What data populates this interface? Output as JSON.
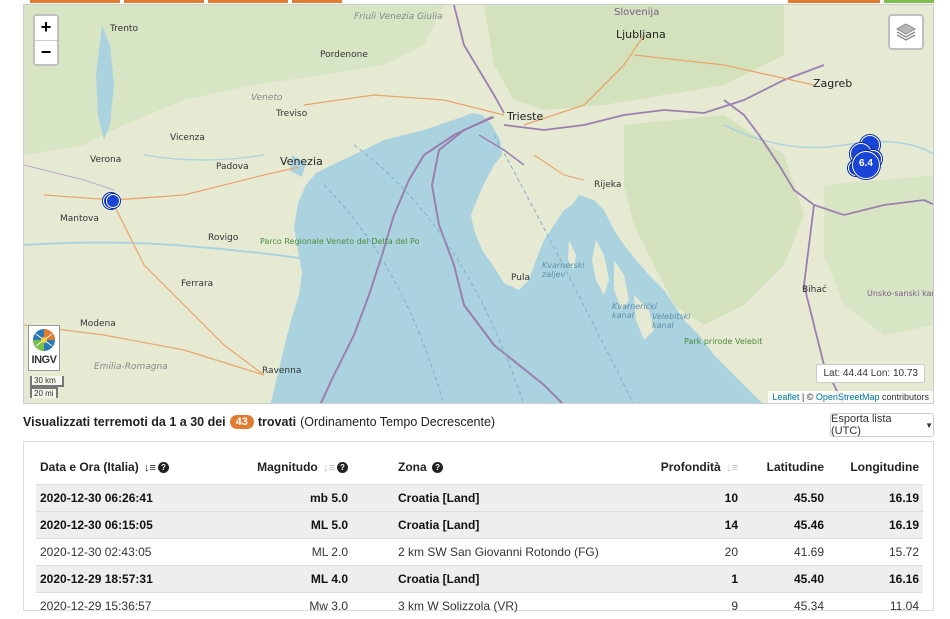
{
  "map": {
    "labels": {
      "trento": "Trento",
      "friuli": "Friuli Venezia Giulia",
      "slovenija": "Slovenija",
      "ljubljana": "Ljubljana",
      "pordenone": "Pordenone",
      "veneto": "Veneto",
      "treviso": "Treviso",
      "zagreb": "Zagreb",
      "trieste": "Trieste",
      "vicenza": "Vicenza",
      "venezia": "Venezia",
      "verona": "Verona",
      "padova": "Padova",
      "rijeka": "Rijeka",
      "mantova": "Mantova",
      "rovigo": "Rovigo",
      "park_po": "Parco Regionale Veneto del Delta del Po",
      "ferrara": "Ferrara",
      "pula": "Pula",
      "kvarnerski_zaljev": "Kvarnerski zaljev",
      "kvarnericki_kanal": "Kvarnerićki kanal",
      "velebitski_kanal": "Velebitski kanal",
      "park_velebit": "Park prirode Velebit",
      "bihac": "Bihać",
      "unsko": "Unsko-sanski kanton",
      "modena": "Modena",
      "emilia": "Emilia-Romagna",
      "ravenna": "Ravenna"
    },
    "zoom_in": "+",
    "zoom_out": "−",
    "logo_text": "INGV",
    "scale_km": "30 km",
    "scale_mi": "20 mi",
    "coords": "Lat: 44.44 Lon: 10.73",
    "attribution_leaflet": "Leaflet",
    "attribution_sep": " | © ",
    "attribution_osm": "OpenStreetMap",
    "attribution_contrib": " contributors",
    "cluster_label": "6.4",
    "colors": {
      "sea": "#aad3df",
      "land": "#e8ecd8",
      "quake": "#1a44d6",
      "border": "#9b7fb0"
    }
  },
  "results": {
    "prefix": "Visualizzati terremoti da 1 a 30 dei",
    "count": "43",
    "found": "trovati",
    "order": "(Ordinamento Tempo Decrescente)",
    "export": "Esporta lista (UTC)"
  },
  "table": {
    "headers": {
      "date": "Data e Ora (Italia)",
      "magnitude": "Magnitudo",
      "zone": "Zona",
      "depth": "Profondità",
      "lat": "Latitudine",
      "lon": "Longitudine"
    },
    "rows": [
      {
        "date": "2020-12-30 06:26:41",
        "mag": "mb 5.0",
        "zone": "Croatia [Land]",
        "depth": "10",
        "lat": "45.50",
        "lon": "16.19"
      },
      {
        "date": "2020-12-30 06:15:05",
        "mag": "ML 5.0",
        "zone": "Croatia [Land]",
        "depth": "14",
        "lat": "45.46",
        "lon": "16.19"
      },
      {
        "date": "2020-12-30 02:43:05",
        "mag": "ML 2.0",
        "zone": "2 km SW San Giovanni Rotondo (FG)",
        "depth": "20",
        "lat": "41.69",
        "lon": "15.72"
      },
      {
        "date": "2020-12-29 18:57:31",
        "mag": "ML 4.0",
        "zone": "Croatia [Land]",
        "depth": "1",
        "lat": "45.40",
        "lon": "16.16"
      },
      {
        "date": "2020-12-29 15:36:57",
        "mag": "Mw 3.0",
        "zone": "3 km W Solizzola (VR)",
        "depth": "9",
        "lat": "45.34",
        "lon": "11.04"
      }
    ]
  }
}
